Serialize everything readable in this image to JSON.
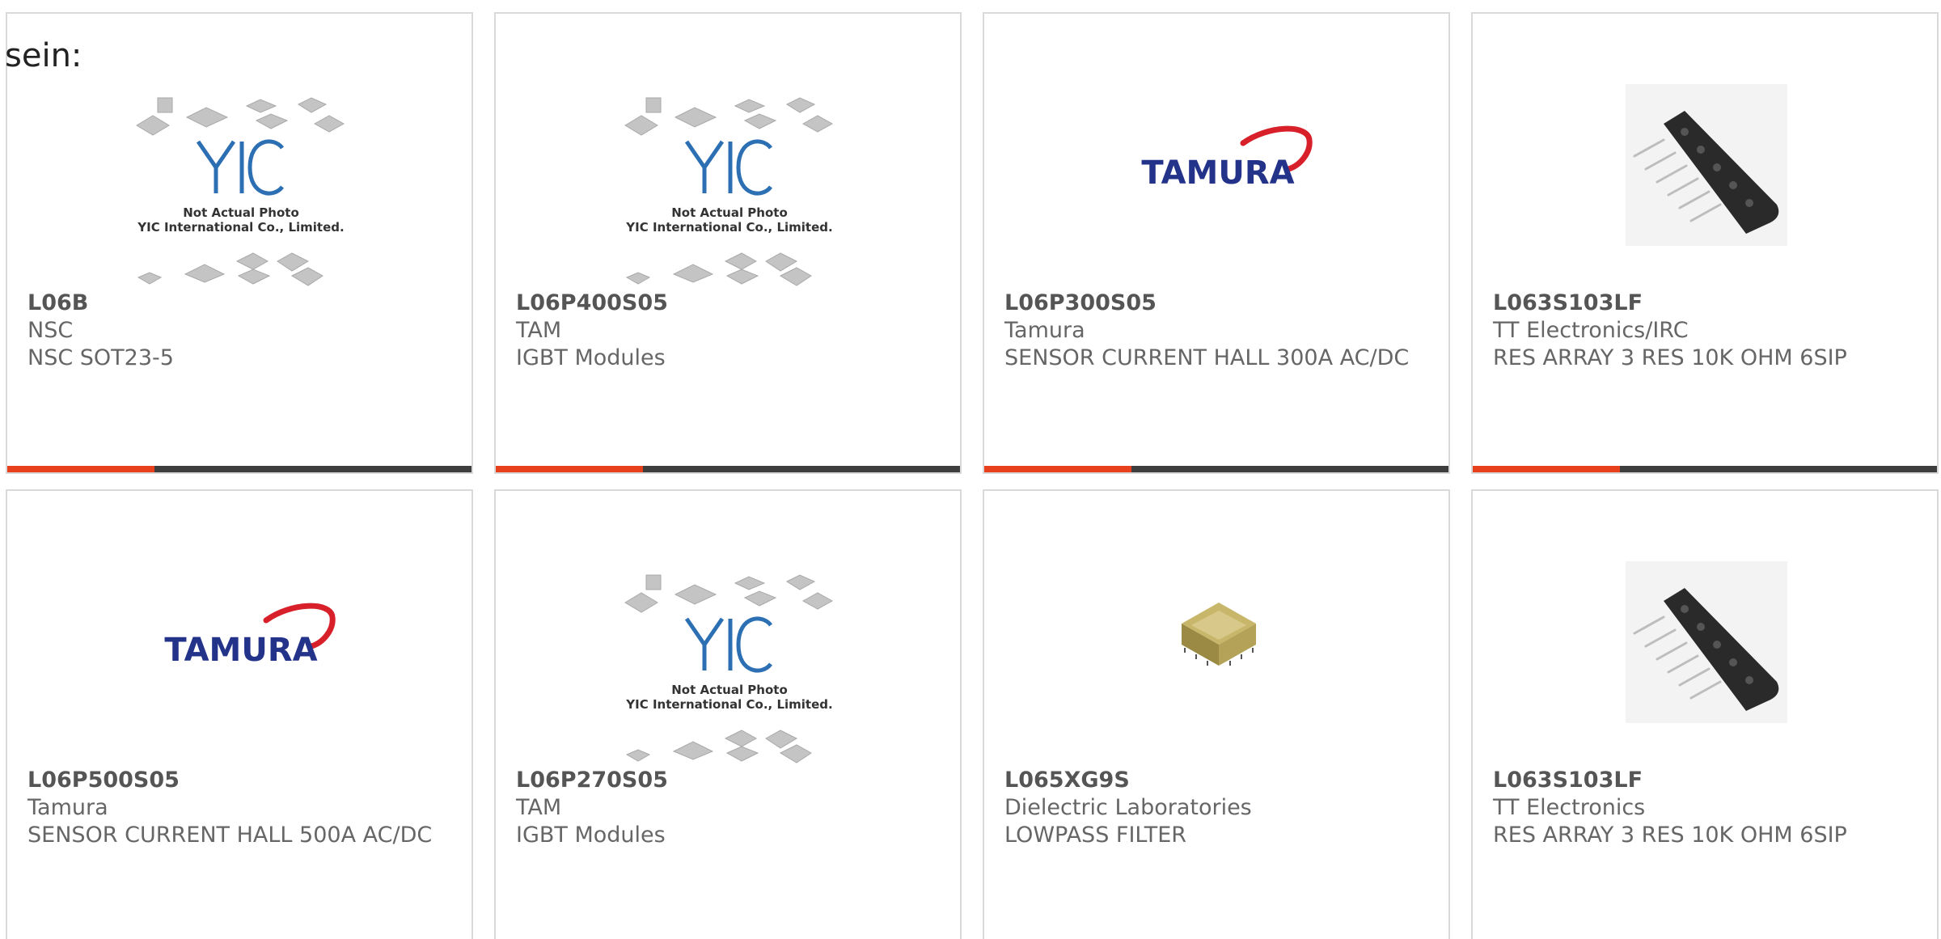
{
  "intro_text": "sein:",
  "theme": {
    "accent_color": "#e8401c",
    "bar_color": "#3e3e3e",
    "border_color": "#d9d9d9"
  },
  "placeholder_image": {
    "line1": "Not Actual Photo",
    "line2": "YIC International Co., Limited.",
    "logo_text": "YIC"
  },
  "tamura_logo_text": "TAMURA",
  "products": [
    {
      "part": "L06B",
      "manufacturer": "NSC",
      "description": "NSC SOT23-5",
      "image": "yic-placeholder"
    },
    {
      "part": "L06P400S05",
      "manufacturer": "TAM",
      "description": "IGBT Modules",
      "image": "yic-placeholder"
    },
    {
      "part": "L06P300S05",
      "manufacturer": "Tamura",
      "description": "SENSOR CURRENT HALL 300A AC/DC",
      "image": "tamura-logo"
    },
    {
      "part": "L063S103LF",
      "manufacturer": "TT Electronics/IRC",
      "description": "RES ARRAY 3 RES 10K OHM 6SIP",
      "image": "resistor-array"
    },
    {
      "part": "L06P500S05",
      "manufacturer": "Tamura",
      "description": "SENSOR CURRENT HALL 500A AC/DC",
      "image": "tamura-logo"
    },
    {
      "part": "L06P270S05",
      "manufacturer": "TAM",
      "description": "IGBT Modules",
      "image": "yic-placeholder"
    },
    {
      "part": "L065XG9S",
      "manufacturer": "Dielectric Laboratories",
      "description": "LOWPASS FILTER",
      "image": "smd-filter-component"
    },
    {
      "part": "L063S103LF",
      "manufacturer": "TT Electronics",
      "description": "RES ARRAY 3 RES 10K OHM 6SIP",
      "image": "resistor-array"
    }
  ]
}
